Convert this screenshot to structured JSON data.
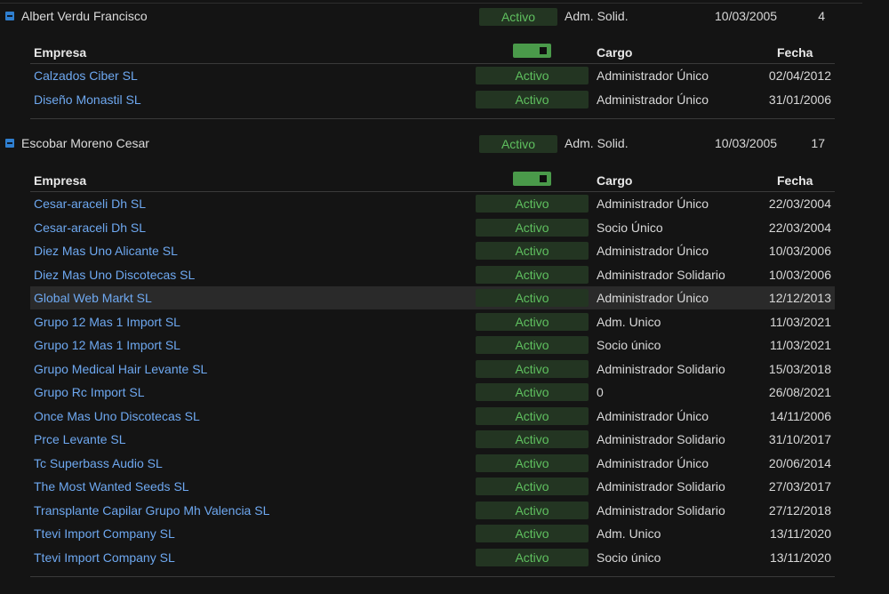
{
  "headers": {
    "empresa": "Empresa",
    "cargo": "Cargo",
    "fecha": "Fecha"
  },
  "persons": [
    {
      "name": "Albert Verdu Francisco",
      "status": "Activo",
      "cargo": "Adm. Solid.",
      "fecha": "10/03/2005",
      "count": "4",
      "companies": [
        {
          "empresa": "Calzados Ciber SL",
          "status": "Activo",
          "cargo": "Administrador Único",
          "fecha": "02/04/2012"
        },
        {
          "empresa": "Diseño Monastil SL",
          "status": "Activo",
          "cargo": "Administrador Único",
          "fecha": "31/01/2006"
        }
      ]
    },
    {
      "name": "Escobar Moreno Cesar",
      "status": "Activo",
      "cargo": "Adm. Solid.",
      "fecha": "10/03/2005",
      "count": "17",
      "companies": [
        {
          "empresa": "Cesar-araceli Dh SL",
          "status": "Activo",
          "cargo": "Administrador Único",
          "fecha": "22/03/2004"
        },
        {
          "empresa": "Cesar-araceli Dh SL",
          "status": "Activo",
          "cargo": "Socio Único",
          "fecha": "22/03/2004"
        },
        {
          "empresa": "Diez Mas Uno Alicante SL",
          "status": "Activo",
          "cargo": "Administrador Único",
          "fecha": "10/03/2006"
        },
        {
          "empresa": "Diez Mas Uno Discotecas SL",
          "status": "Activo",
          "cargo": "Administrador Solidario",
          "fecha": "10/03/2006"
        },
        {
          "empresa": "Global Web Markt SL",
          "status": "Activo",
          "cargo": "Administrador Único",
          "fecha": "12/12/2013"
        },
        {
          "empresa": "Grupo 12 Mas 1 Import SL",
          "status": "Activo",
          "cargo": "Adm. Unico",
          "fecha": "11/03/2021"
        },
        {
          "empresa": "Grupo 12 Mas 1 Import SL",
          "status": "Activo",
          "cargo": "Socio único",
          "fecha": "11/03/2021"
        },
        {
          "empresa": "Grupo Medical Hair Levante SL",
          "status": "Activo",
          "cargo": "Administrador Solidario",
          "fecha": "15/03/2018"
        },
        {
          "empresa": "Grupo Rc Import SL",
          "status": "Activo",
          "cargo": "0",
          "fecha": "26/08/2021"
        },
        {
          "empresa": "Once Mas Uno Discotecas SL",
          "status": "Activo",
          "cargo": "Administrador Único",
          "fecha": "14/11/2006"
        },
        {
          "empresa": "Prce Levante SL",
          "status": "Activo",
          "cargo": "Administrador Solidario",
          "fecha": "31/10/2017"
        },
        {
          "empresa": "Tc Superbass Audio SL",
          "status": "Activo",
          "cargo": "Administrador Único",
          "fecha": "20/06/2014"
        },
        {
          "empresa": "The Most Wanted Seeds SL",
          "status": "Activo",
          "cargo": "Administrador Solidario",
          "fecha": "27/03/2017"
        },
        {
          "empresa": "Transplante Capilar Grupo Mh Valencia SL",
          "status": "Activo",
          "cargo": "Administrador Solidario",
          "fecha": "27/12/2018"
        },
        {
          "empresa": "Ttevi Import Company SL",
          "status": "Activo",
          "cargo": "Adm. Unico",
          "fecha": "13/11/2020"
        },
        {
          "empresa": "Ttevi Import Company SL",
          "status": "Activo",
          "cargo": "Socio único",
          "fecha": "13/11/2020"
        }
      ]
    }
  ],
  "colors": {
    "link": "#6ea8f0",
    "badge_bg": "#233522",
    "badge_text": "#5fc05f",
    "toggle": "#2f7fd0"
  }
}
